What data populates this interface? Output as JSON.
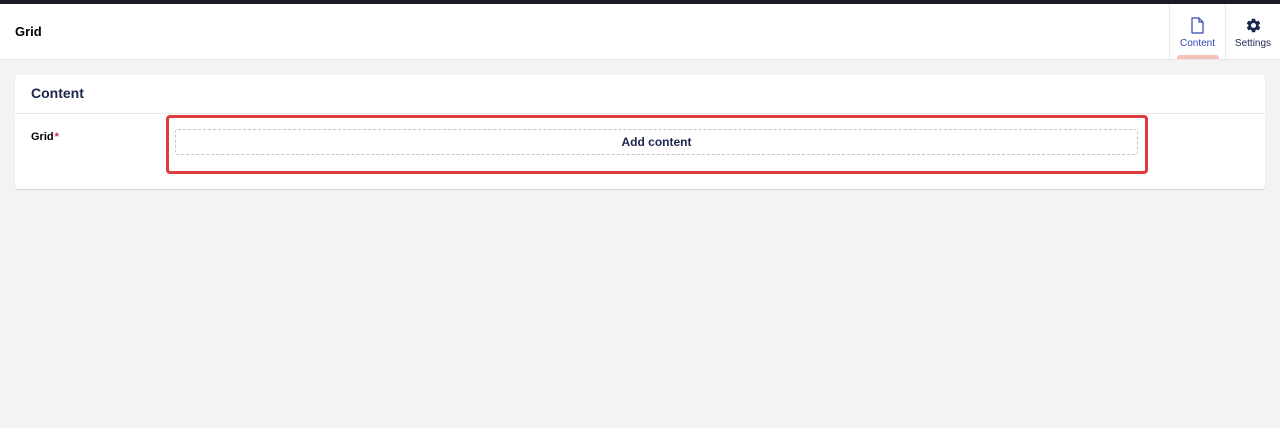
{
  "header": {
    "title": "Grid"
  },
  "app_tabs": [
    {
      "label": "Content",
      "icon": "document-icon",
      "active": true
    },
    {
      "label": "Settings",
      "icon": "gear-icon",
      "active": false
    }
  ],
  "panel": {
    "title": "Content",
    "property": {
      "label": "Grid",
      "required_marker": "*",
      "button_label": "Add content"
    }
  },
  "colors": {
    "accent": "#3544b1",
    "highlight": "#de3c3c",
    "active_indicator": "#f5c1bc",
    "required": "#d42054",
    "text": "#1b264f"
  }
}
